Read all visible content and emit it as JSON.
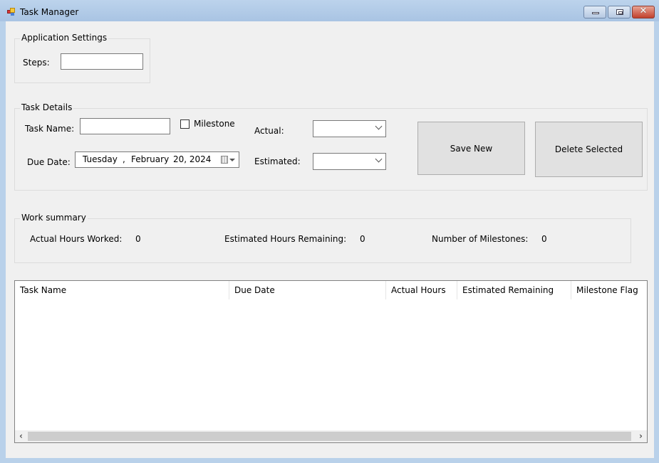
{
  "window": {
    "title": "Task Manager",
    "controls": {
      "minimize": "minimize",
      "maximize": "restore",
      "close": "✕"
    }
  },
  "application_settings": {
    "title": "Application Settings",
    "steps_label": "Steps:",
    "steps_value": ""
  },
  "task_details": {
    "title": "Task Details",
    "task_name_label": "Task Name:",
    "task_name_value": "",
    "milestone_label": "Milestone",
    "milestone_checked": false,
    "due_date_label": "Due Date:",
    "due_date": {
      "weekday": "Tuesday",
      "sep": ",",
      "month": "February",
      "day_year": "20, 2024"
    },
    "actual_label": "Actual:",
    "actual_value": "",
    "estimated_label": "Estimated:",
    "estimated_value": "",
    "save_button": "Save New",
    "delete_button": "Delete Selected"
  },
  "work_summary": {
    "title": "Work summary",
    "actual_hours_label": "Actual Hours Worked:",
    "actual_hours_value": "0",
    "estimated_remaining_label": "Estimated Hours Remaining:",
    "estimated_remaining_value": "0",
    "milestones_label": "Number of Milestones:",
    "milestones_value": "0"
  },
  "task_list": {
    "columns": [
      "Task Name",
      "Due Date",
      "Actual Hours",
      "Estimated Remaining",
      "Milestone Flag"
    ],
    "rows": []
  },
  "scrollbar": {
    "left_arrow": "‹",
    "right_arrow": "›"
  }
}
